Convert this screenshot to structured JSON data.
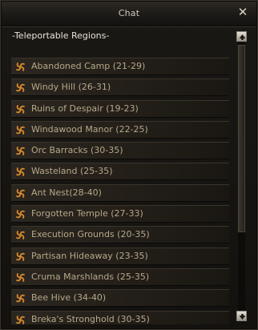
{
  "window": {
    "title": "Chat",
    "close_icon": "close-icon"
  },
  "content": {
    "header": "-Teleportable Regions-",
    "items": [
      {
        "label": "Abandoned Camp (21-29)"
      },
      {
        "label": "Windy Hill (26-31)"
      },
      {
        "label": "Ruins of Despair (19-23)"
      },
      {
        "label": "Windawood Manor (22-25)"
      },
      {
        "label": "Orc Barracks (30-35)"
      },
      {
        "label": "Wasteland (25-35)"
      },
      {
        "label": "Ant Nest(28-40)"
      },
      {
        "label": "Forgotten Temple (27-33)"
      },
      {
        "label": "Execution Grounds (20-35)"
      },
      {
        "label": "Partisan Hideaway (23-35)"
      },
      {
        "label": "Cruma Marshlands (25-35)"
      },
      {
        "label": "Bee Hive (34-40)"
      },
      {
        "label": "Breka's Stronghold (30-35)"
      }
    ]
  },
  "icons": {
    "item_icon": "swirl-teleport-icon",
    "scroll_up_icon": "arrow-up-icon",
    "scroll_down_icon": "arrow-down-icon"
  },
  "scroll": {
    "thumb_fraction": 0.7
  },
  "colors": {
    "label": "#b6a889",
    "header": "#e8e2d6",
    "icon": "#d9892a"
  }
}
